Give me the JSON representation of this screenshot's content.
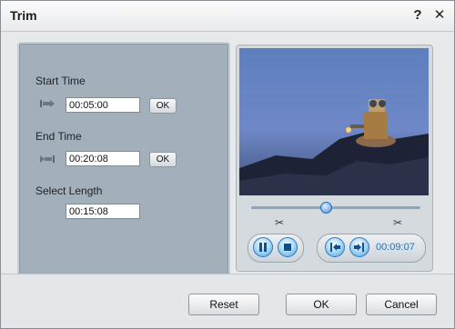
{
  "window": {
    "title": "Trim",
    "help_label": "?",
    "close_label": "✕"
  },
  "trim": {
    "start_time_label": "Start Time",
    "start_time_value": "00:05:00",
    "end_time_label": "End Time",
    "end_time_value": "00:20:08",
    "select_length_label": "Select Length",
    "select_length_value": "00:15:08",
    "ok_label": "OK"
  },
  "preview": {
    "current_time": "00:09:07",
    "position_fraction": 0.44
  },
  "footer": {
    "reset_label": "Reset",
    "ok_label": "OK",
    "cancel_label": "Cancel"
  },
  "icons": {
    "set_start": "set-start-icon",
    "set_end": "set-end-icon",
    "scissor_left": "scissor-icon",
    "scissor_right": "scissor-icon",
    "pause": "pause-icon",
    "stop": "stop-icon",
    "mark_start": "mark-start-icon",
    "mark_end": "mark-end-icon"
  }
}
